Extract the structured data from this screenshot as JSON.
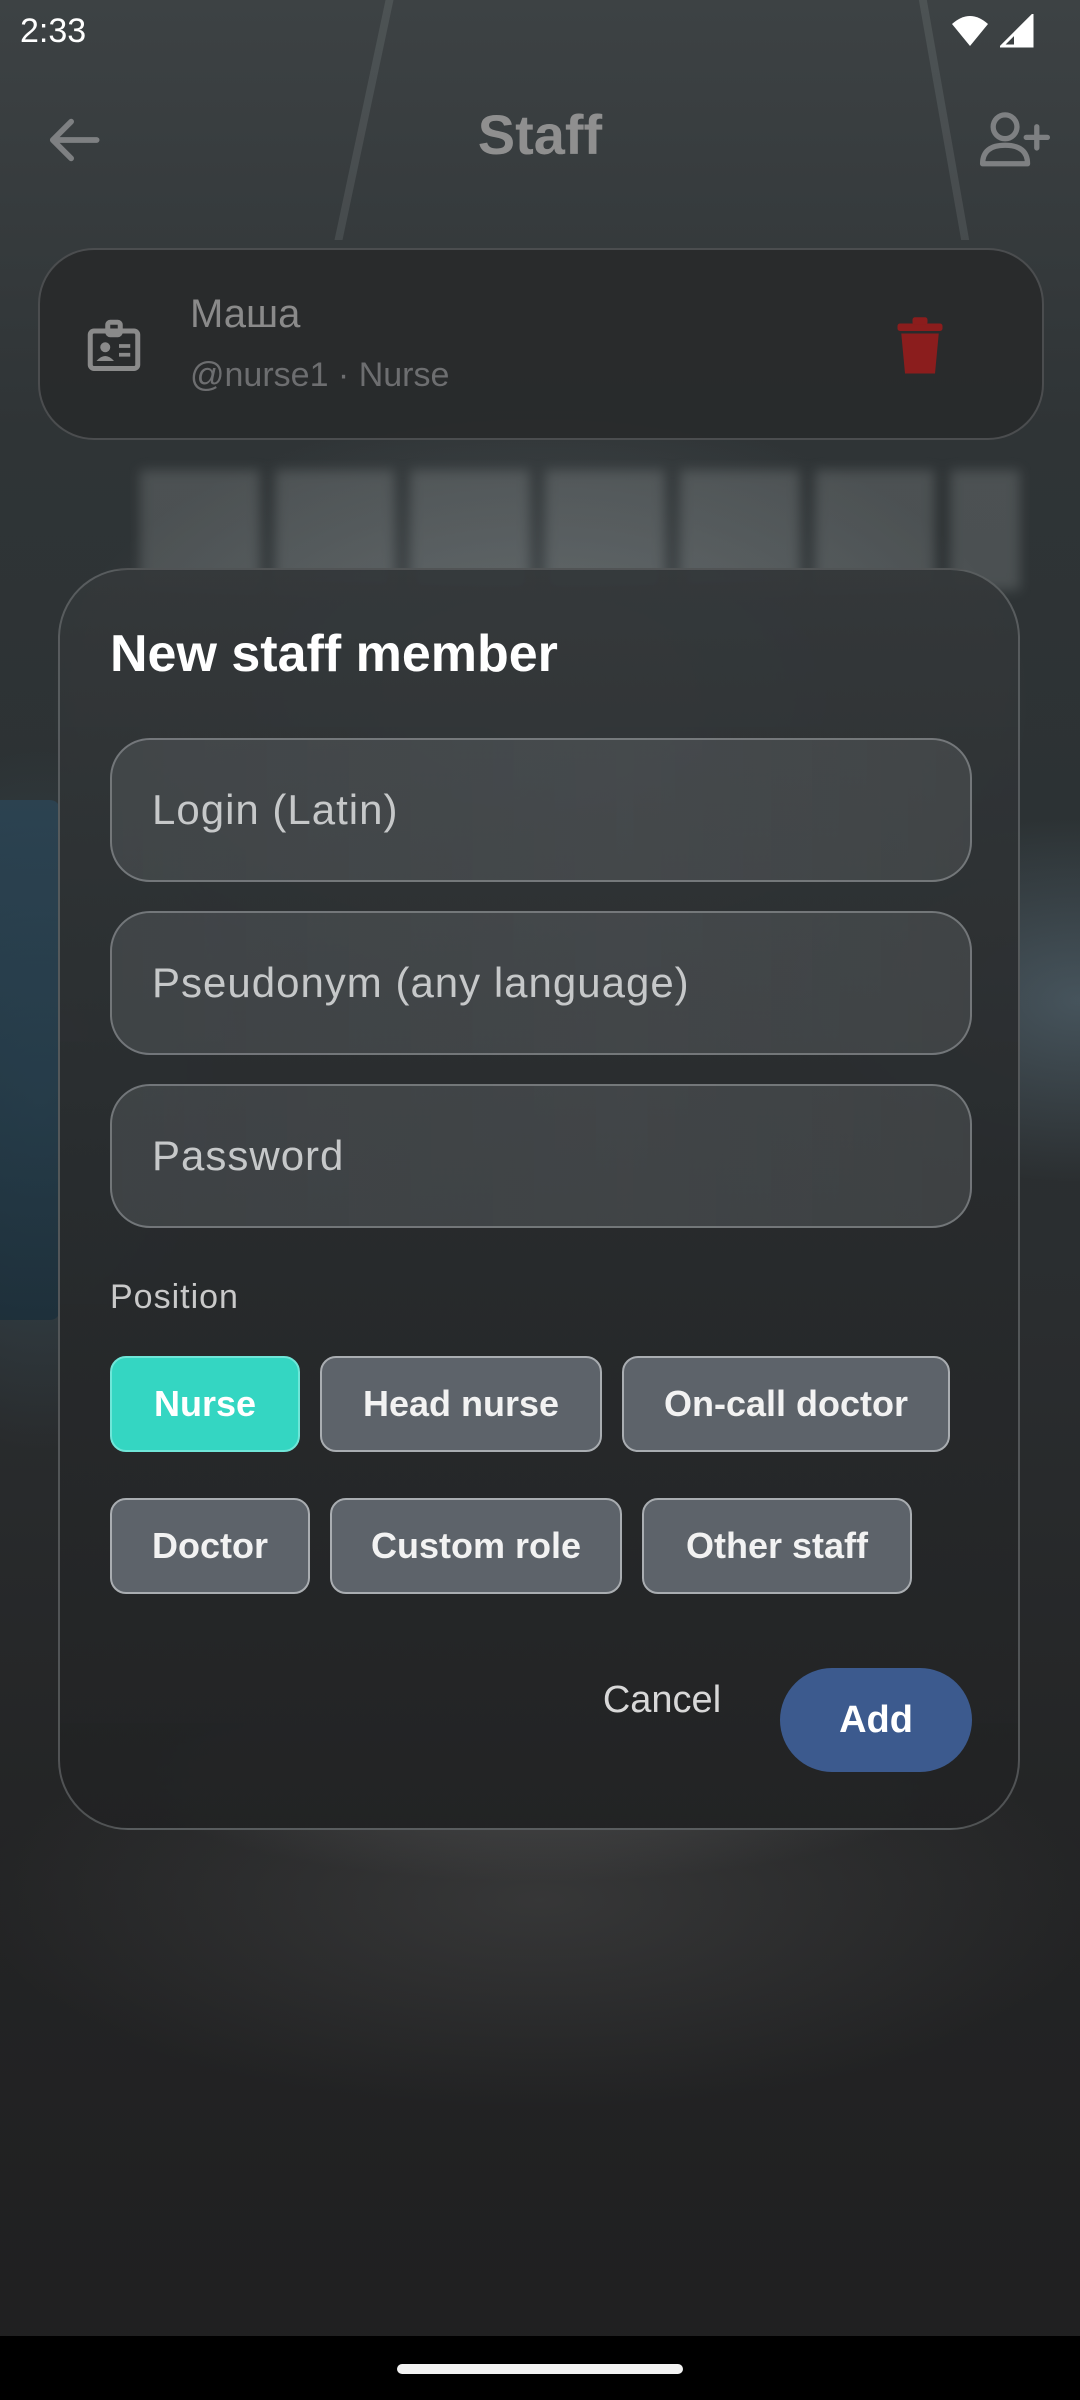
{
  "status_bar": {
    "time": "2:33",
    "icons": [
      "wifi-icon",
      "cellular-signal-icon"
    ]
  },
  "app_bar": {
    "title": "Staff",
    "back_icon": "arrow-back-icon",
    "action_icon": "person-add-icon"
  },
  "staff_list": [
    {
      "name": "Маша",
      "subtitle": "@nurse1 · Nurse",
      "icon": "id-badge-icon",
      "action_icon": "trash-icon"
    }
  ],
  "dialog": {
    "title": "New staff member",
    "fields": {
      "login": {
        "placeholder": "Login (Latin)",
        "value": ""
      },
      "pseudonym": {
        "placeholder": "Pseudonym (any language)",
        "value": ""
      },
      "password": {
        "placeholder": "Password",
        "value": ""
      }
    },
    "position_label": "Position",
    "positions": [
      {
        "label": "Nurse",
        "selected": true
      },
      {
        "label": "Head nurse",
        "selected": false
      },
      {
        "label": "On-call doctor",
        "selected": false
      },
      {
        "label": "Doctor",
        "selected": false
      },
      {
        "label": "Custom role",
        "selected": false
      },
      {
        "label": "Other staff",
        "selected": false
      }
    ],
    "cancel_label": "Cancel",
    "add_label": "Add"
  },
  "colors": {
    "accent_selected": "#34d6c2",
    "primary_button": "#3c5a8e",
    "delete": "#8b1d1d"
  }
}
